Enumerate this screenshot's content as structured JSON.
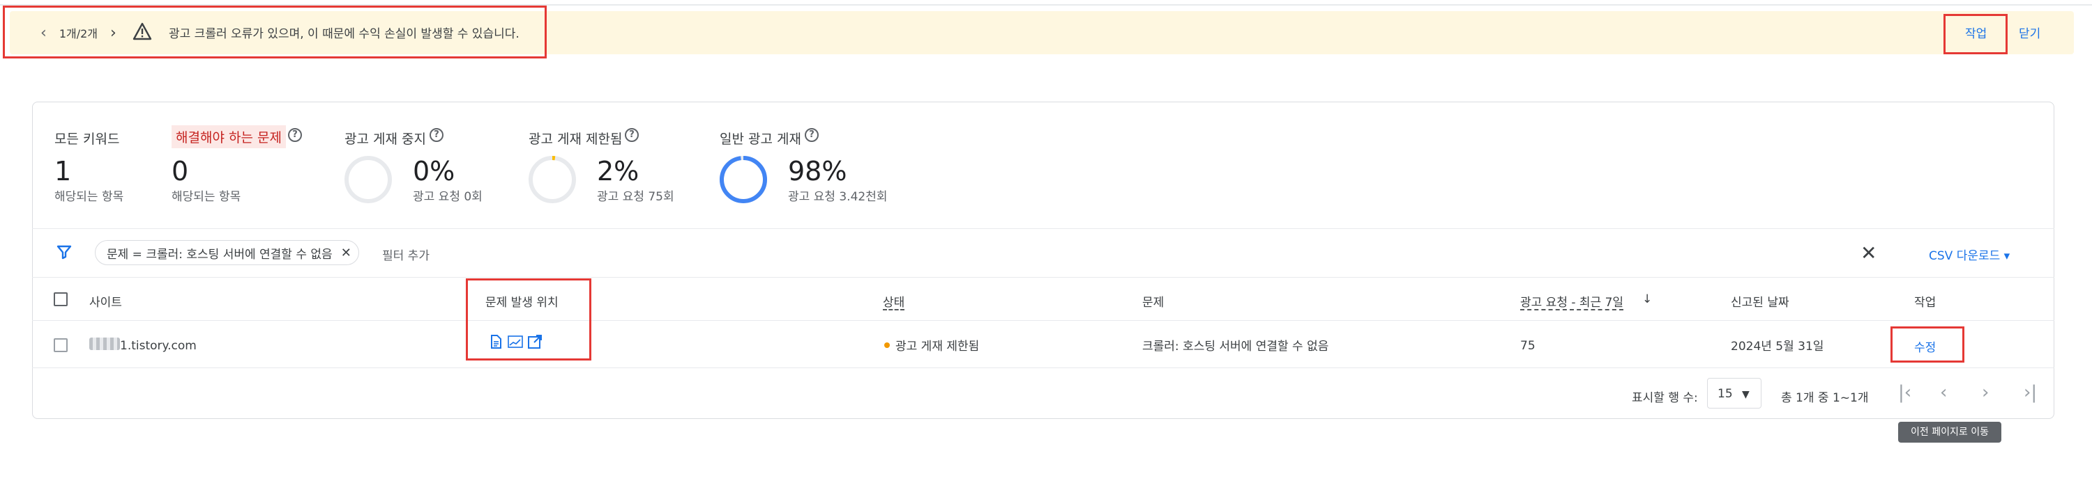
{
  "banner": {
    "pager_count": "1개/2개",
    "message": "광고 크롤러 오류가 있으며, 이 때문에 수익 손실이 발생할 수 있습니다.",
    "action_label": "작업",
    "close_label": "닫기",
    "background_color": "#fef7e0",
    "link_color": "#1a73e8"
  },
  "summary": {
    "all_keywords": {
      "label": "모든 키워드",
      "value": "1",
      "sub": "해당되는 항목"
    },
    "issues": {
      "label": "해결해야 하는 문제",
      "value": "0",
      "sub": "해당되는 항목"
    },
    "serving_stopped": {
      "label": "광고 게재 중지",
      "percent": "0%",
      "sub": "광고 요청 0회",
      "fraction": 0
    },
    "serving_limited": {
      "label": "광고 게재 제한됨",
      "percent": "2%",
      "sub": "광고 요청 75회",
      "fraction": 0.02
    },
    "serving_normal": {
      "label": "일반 광고 게재",
      "percent": "98%",
      "sub": "광고 요청 3.42천회",
      "fraction": 0.98
    },
    "ring_color": "#4285f4",
    "ring_track_color": "#e8eaed"
  },
  "filters": {
    "chip_label": "문제 = 크롤러: 호스팅 서버에 연결할 수 없음",
    "add_placeholder": "필터 추가",
    "csv_label": "CSV 다운로드"
  },
  "table": {
    "headers": {
      "site": "사이트",
      "location": "문제 발생 위치",
      "status": "상태",
      "problem": "문제",
      "requests": "광고 요청 - 최근 7일",
      "reported": "신고된 날짜",
      "action": "작업"
    },
    "rows": [
      {
        "site": "1.tistory.com",
        "status": "광고 게재 제한됨",
        "problem": "크롤러: 호스팅 서버에 연결할 수 없음",
        "requests": "75",
        "reported": "2024년 5월 31일",
        "action": "수정"
      }
    ]
  },
  "pagination": {
    "rows_label": "표시할 행 수:",
    "rows_value": "15",
    "range": "총 1개 중 1~1개",
    "tooltip": "이전 페이지로 이동"
  }
}
